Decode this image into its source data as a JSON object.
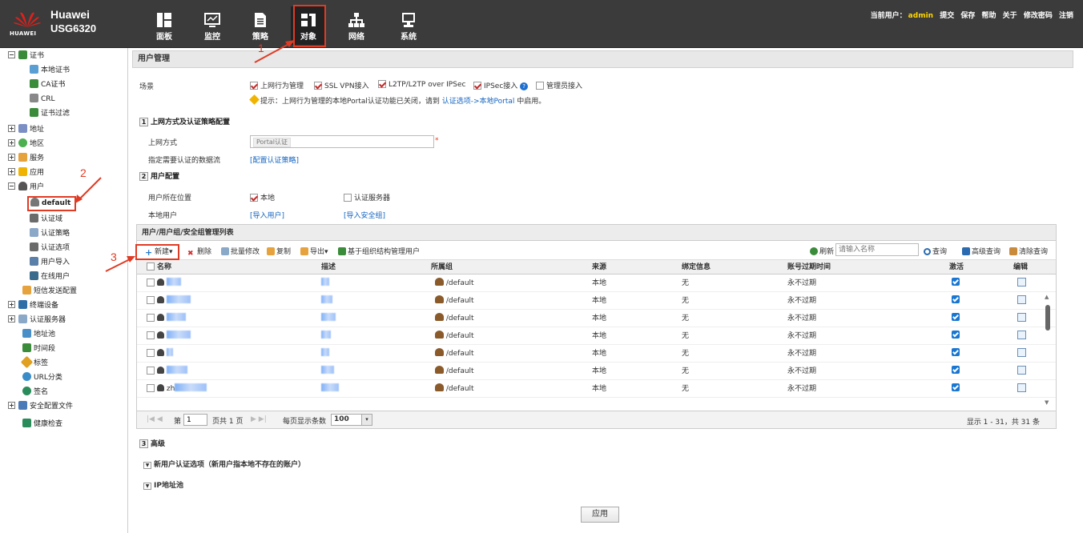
{
  "header": {
    "brand": "Huawei",
    "model": "USG6320",
    "logo_text": "HUAWEI",
    "nav": [
      {
        "label": "面板",
        "icon": "dashboard-icon"
      },
      {
        "label": "监控",
        "icon": "monitor-icon"
      },
      {
        "label": "策略",
        "icon": "policy-icon"
      },
      {
        "label": "对象",
        "icon": "object-icon"
      },
      {
        "label": "网络",
        "icon": "network-icon"
      },
      {
        "label": "系统",
        "icon": "system-icon"
      }
    ],
    "user_label": "当前用户：",
    "user_name": "admin",
    "links": [
      "提交",
      "保存",
      "帮助",
      "关于",
      "修改密码",
      "注销"
    ]
  },
  "sidebar": {
    "items": [
      {
        "label": "证书"
      },
      {
        "label": "本地证书"
      },
      {
        "label": "CA证书"
      },
      {
        "label": "CRL"
      },
      {
        "label": "证书过滤"
      },
      {
        "label": "地址"
      },
      {
        "label": "地区"
      },
      {
        "label": "服务"
      },
      {
        "label": "应用"
      },
      {
        "label": "用户"
      },
      {
        "label": "default"
      },
      {
        "label": "认证域"
      },
      {
        "label": "认证策略"
      },
      {
        "label": "认证选项"
      },
      {
        "label": "用户导入"
      },
      {
        "label": "在线用户"
      },
      {
        "label": "短信发送配置"
      },
      {
        "label": "终端设备"
      },
      {
        "label": "认证服务器"
      },
      {
        "label": "地址池"
      },
      {
        "label": "时间段"
      },
      {
        "label": "标签"
      },
      {
        "label": "URL分类"
      },
      {
        "label": "签名"
      },
      {
        "label": "安全配置文件"
      },
      {
        "label": "健康检查"
      }
    ]
  },
  "main": {
    "title": "用户管理",
    "scene_label": "场景",
    "scenes": [
      {
        "label": "上网行为管理",
        "checked": true
      },
      {
        "label": "SSL VPN接入",
        "checked": true
      },
      {
        "label": "L2TP/L2TP over IPSec",
        "checked": true
      },
      {
        "label": "IPSec接入",
        "checked": true
      },
      {
        "label": "管理员接入",
        "checked": false
      }
    ],
    "tip_prefix": "提示：上网行为管理的本地Portal认证功能已关闭，请到",
    "tip_link": "认证选项->本地Portal",
    "tip_suffix": "中启用。",
    "sec1_num": "1",
    "sec1_title": "上网方式及认证策略配置",
    "access_label": "上网方式",
    "access_value": "Portal认证",
    "flow_label": "指定需要认证的数据流",
    "flow_link": "[配置认证策略]",
    "sec2_num": "2",
    "sec2_title": "用户配置",
    "loc_label": "用户所在位置",
    "loc_local": "本地",
    "loc_server": "认证服务器",
    "local_user_label": "本地用户",
    "import_user": "[导入用户]",
    "import_group": "[导入安全组]",
    "sec3_num": "3",
    "sec3_title": "高级",
    "adv1": "新用户认证选项（新用户指本地不存在的账户）",
    "adv2": "IP地址池",
    "apply": "应用"
  },
  "grid": {
    "title": "用户/用户组/安全组管理列表",
    "toolbar": {
      "new": "新建",
      "delete": "删除",
      "batch": "批量修改",
      "copy": "复制",
      "export": "导出",
      "org": "基于组织结构管理用户",
      "refresh": "刷新",
      "search_placeholder": "请输入名称",
      "query": "查询",
      "advanced": "高级查询",
      "clear": "清除查询"
    },
    "columns": [
      "名称",
      "描述",
      "所属组",
      "来源",
      "绑定信息",
      "账号过期时间",
      "激活",
      "编辑"
    ],
    "rows": [
      {
        "group": "/default",
        "source": "本地",
        "bind": "无",
        "expire": "永不过期",
        "name_tail": ""
      },
      {
        "group": "/default",
        "source": "本地",
        "bind": "无",
        "expire": "永不过期",
        "name_tail": ""
      },
      {
        "group": "/default",
        "source": "本地",
        "bind": "无",
        "expire": "永不过期",
        "name_tail": ""
      },
      {
        "group": "/default",
        "source": "本地",
        "bind": "无",
        "expire": "永不过期",
        "name_tail": ""
      },
      {
        "group": "/default",
        "source": "本地",
        "bind": "无",
        "expire": "永不过期",
        "name_tail": ""
      },
      {
        "group": "/default",
        "source": "本地",
        "bind": "无",
        "expire": "永不过期",
        "name_tail": ""
      },
      {
        "group": "/default",
        "source": "本地",
        "bind": "无",
        "expire": "永不过期",
        "name_tail": "zh"
      }
    ],
    "pager": {
      "page_prefix": "第",
      "page": "1",
      "page_total": "页共 1 页",
      "per_page_label": "每页显示条数",
      "per_page": "100",
      "summary": "显示 1 - 31，共 31 条"
    }
  },
  "annotations": [
    "1",
    "2",
    "3"
  ],
  "colors": {
    "header_bg": "#3b3b3b",
    "highlight": "#e03b24",
    "link": "#1565c0"
  }
}
